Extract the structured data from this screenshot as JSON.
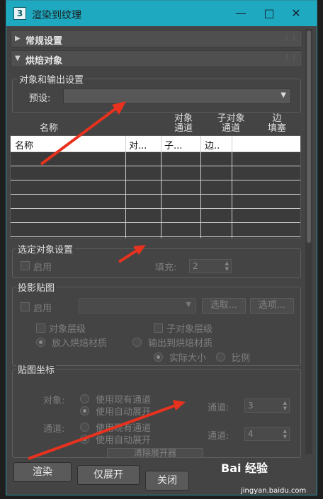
{
  "window": {
    "title": "渲染到纹理",
    "icon_glyph": "3"
  },
  "rollouts": {
    "general": "常规设置",
    "bake_objects": "烘焙对象"
  },
  "object_output": {
    "group_label": "对象和输出设置",
    "preset_label": "预设:",
    "preset_value": ""
  },
  "columns": {
    "name": "名称",
    "object_channel": [
      "对象",
      "通道"
    ],
    "sub_object_channel": [
      "子对象",
      "通道"
    ],
    "edge_padding": [
      "边",
      "填塞"
    ]
  },
  "grid_header": {
    "name": "名称",
    "col2": "对...",
    "col3": "子...",
    "col4": "边.."
  },
  "selected": {
    "group_label": "选定对象设置",
    "enable_label": "启用",
    "padding_label": "填充:",
    "padding_value": "2"
  },
  "projection": {
    "group_label": "投影贴图",
    "enable_label": "启用",
    "pick_button": "选取...",
    "options_button": "选项...",
    "object_level": "对象层级",
    "sub_object_level": "子对象层级",
    "put_to_bake": "放入烘焙材质",
    "output_to_bake": "输出到烘焙材质",
    "actual_size": "实际大小",
    "proportional": "比例"
  },
  "mapping": {
    "group_label": "贴图坐标",
    "object_label": "对象:",
    "channel_label": "通道:",
    "use_existing_1": "使用现有通道",
    "use_auto_1": "使用自动展开",
    "use_existing_2": "使用现有通道",
    "use_auto_2": "使用自动展开",
    "channel_label_a": "通道:",
    "channel_value_a": "3",
    "channel_label_b": "通道:",
    "channel_value_b": "4",
    "clear_unwrapper": "清除展开器"
  },
  "footer": {
    "render": "渲染",
    "unwrap_only": "仅展开",
    "close": "关闭"
  },
  "watermark": {
    "brand": "Bai 经验",
    "url": "jingyan.baidu.com"
  },
  "colors": {
    "titlebar": "#1ea9c0",
    "panel": "#444444",
    "annotation": "#e8321e"
  }
}
